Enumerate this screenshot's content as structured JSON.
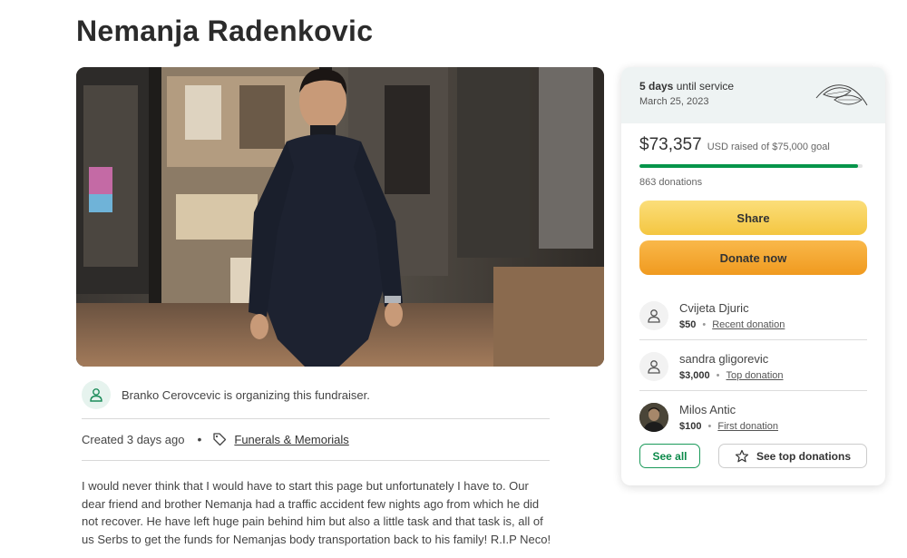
{
  "page": {
    "title": "Nemanja Radenkovic"
  },
  "organizer": {
    "text": "Branko Cerovcevic is organizing this fundraiser.",
    "icon": "user-icon"
  },
  "meta": {
    "created": "Created 3 days ago",
    "separator": "•",
    "category": "Funerals & Memorials",
    "category_icon": "tag-icon"
  },
  "story": "I would never think that I would have to start this page but unfortunately I have to. Our dear friend and brother Nemanja had a traffic accident few nights ago from which he did not recover. He have left huge pain behind him but also a little task and that task is, all of us Serbs to get the funds for Nemanjas body transportation back to his family! R.I.P Neco!",
  "service": {
    "days": "5 days",
    "until": "until service",
    "date": "March 25, 2023"
  },
  "progress": {
    "raised": "$73,357",
    "goal_text": "USD raised of $75,000 goal",
    "fraction": 0.978,
    "donations": "863 donations",
    "bar_color": "#06954a"
  },
  "actions": {
    "share": "Share",
    "donate": "Donate now"
  },
  "donors": [
    {
      "name": "Cvijeta Djuric",
      "amount": "$50",
      "kind": "Recent donation",
      "avatar": "user-icon"
    },
    {
      "name": "sandra gligorevic",
      "amount": "$3,000",
      "kind": "Top donation",
      "avatar": "user-icon"
    },
    {
      "name": "Milos Antic",
      "amount": "$100",
      "kind": "First donation",
      "avatar": "photo"
    }
  ],
  "footer": {
    "see_all": "See all",
    "see_top": "See top donations"
  }
}
